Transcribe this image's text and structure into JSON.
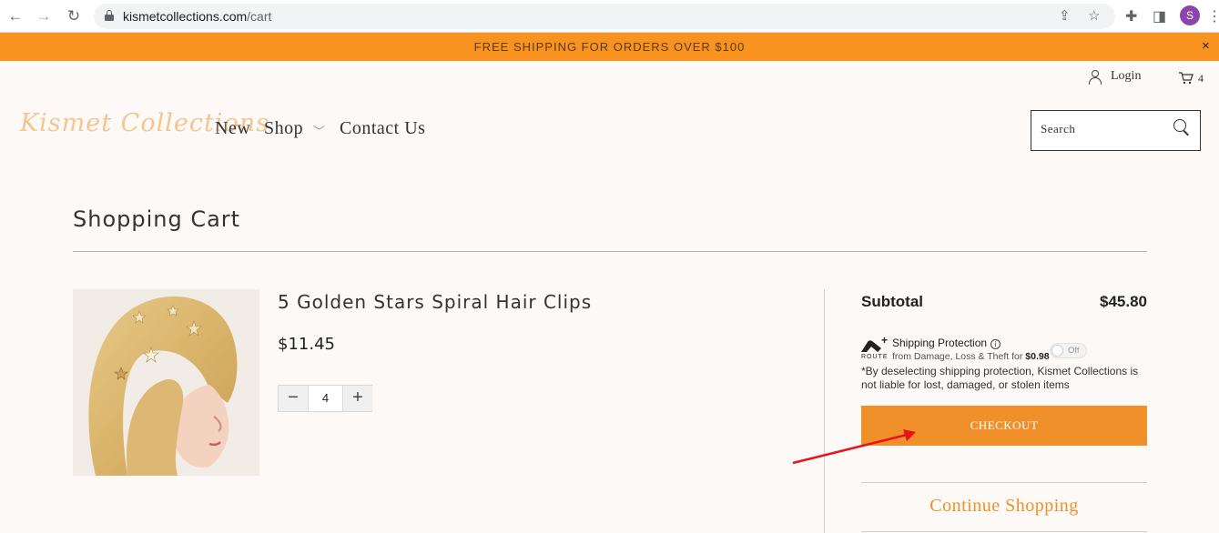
{
  "browser": {
    "url_host": "kismetcollections.com",
    "url_path": "/cart",
    "profile_initial": "S",
    "icons": [
      "back-icon",
      "forward-icon",
      "reload-icon",
      "lock-icon",
      "share-icon",
      "star-icon",
      "extensions-icon",
      "sidepanel-icon",
      "profile-avatar"
    ]
  },
  "announcement": {
    "text": "FREE SHIPPING FOR ORDERS OVER $100",
    "close": "×"
  },
  "header": {
    "login_label": "Login",
    "cart_count": "4",
    "logo_text": "Kismet Collections",
    "nav": {
      "new": "New",
      "shop": "Shop",
      "contact": "Contact Us"
    },
    "search_placeholder": "Search"
  },
  "cart": {
    "title": "Shopping Cart",
    "item": {
      "name": "5 Golden Stars Spiral Hair Clips",
      "price": "$11.45",
      "quantity": "4"
    },
    "summary": {
      "subtotal_label": "Subtotal",
      "subtotal_value": "$45.80",
      "route_label": "ROUTE",
      "shipping_protection_title": "Shipping Protection",
      "shipping_protection_sub": "from Damage, Loss & Theft for ",
      "shipping_protection_price": "$0.98",
      "toggle_state": "Off",
      "disclaimer": "*By deselecting shipping protection, Kismet Collections is not liable for lost, damaged, or stolen items",
      "checkout_label": "CHECKOUT",
      "continue_label": "Continue Shopping"
    }
  },
  "colors": {
    "announcement_bg": "#f7931e",
    "checkout_bg": "#f0902a",
    "page_bg": "#fdf9f6",
    "annotation_arrow": "#e8141c"
  }
}
